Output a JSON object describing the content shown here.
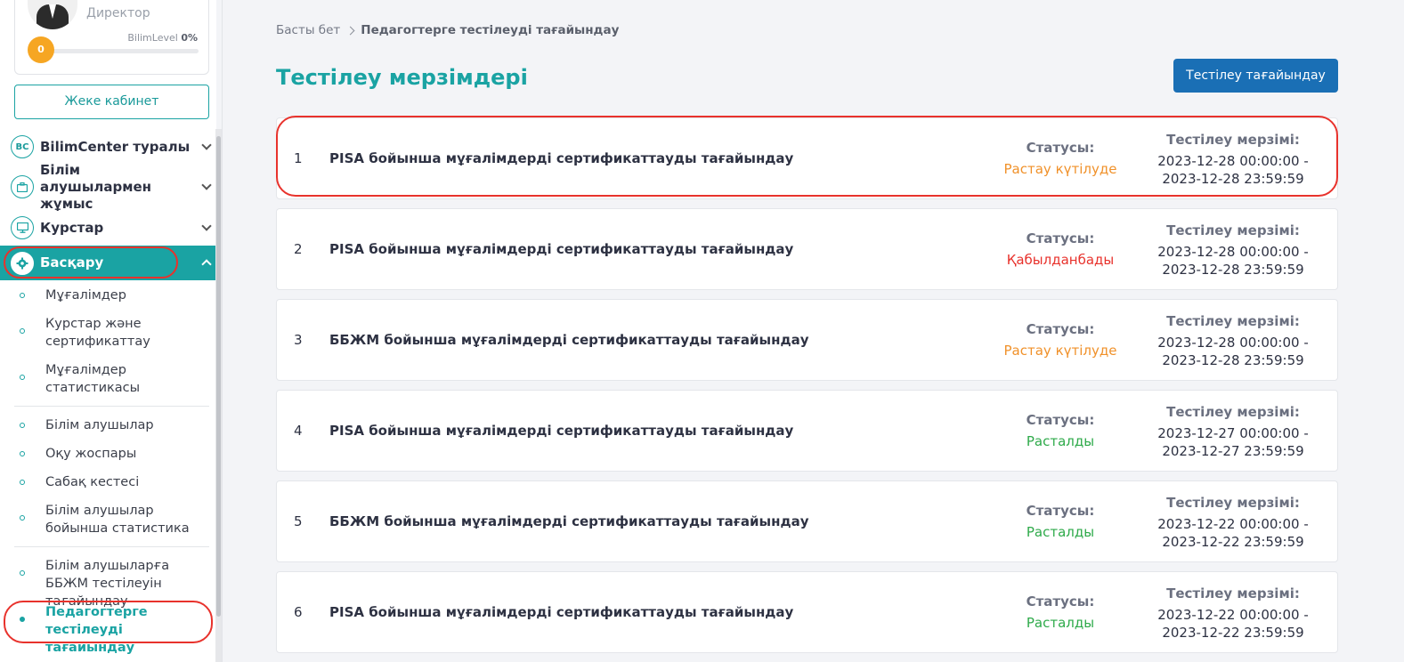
{
  "colors": {
    "accent": "#1aa3a3",
    "primary_button": "#1a6fb5",
    "highlight": "#e8322c",
    "status_pending": "#f0912a",
    "status_rejected": "#e8322c",
    "status_approved": "#2eaa4a",
    "level_badge": "#f6a623"
  },
  "profile": {
    "role": "Директор",
    "level_name": "BilimLevel",
    "level_percent": "0%",
    "level_value": "0",
    "level_fraction": 0
  },
  "sidebar": {
    "cabinet_button": "Жеке кабинет",
    "menu": [
      {
        "label": "BilimCenter туралы",
        "icon": "bc-logo-icon",
        "icon_text": "BC"
      },
      {
        "label": "Білім алушылармен жұмыс",
        "icon": "briefcase-icon"
      },
      {
        "label": "Курстар",
        "icon": "monitor-icon"
      },
      {
        "label": "Басқару",
        "icon": "gear-icon",
        "active": true
      }
    ],
    "sub_items": [
      {
        "label": "Мұғалімдер"
      },
      {
        "label": "Курстар және сертификаттау"
      },
      {
        "label": "Мұғалімдер статистикасы"
      },
      {
        "label": "Білім алушылар"
      },
      {
        "label": "Оқу жоспары"
      },
      {
        "label": "Сабақ кестесі"
      },
      {
        "label": "Білім алушылар бойынша статистика"
      },
      {
        "label": "Білім алушыларға ББЖМ тестілеуін тағайындау"
      },
      {
        "label": "Педагогтерге тестілеуді тағайындау",
        "active": true
      }
    ]
  },
  "breadcrumb": {
    "home": "Басты бет",
    "current": "Педагогтерге тестілеуді тағайындау"
  },
  "page": {
    "title": "Тестілеу мерзімдері",
    "assign_button": "Тестілеу тағайындау"
  },
  "table": {
    "status_label": "Статусы:",
    "deadline_label": "Тестілеу мерзімі:",
    "rows": [
      {
        "num": "1",
        "title": "PISA бойынша мұғалімдерді сертификаттауды тағайындау",
        "status": "Растау күтілуде",
        "status_type": "pending",
        "start": "2023-12-28 00:00:00 -",
        "end": "2023-12-28 23:59:59"
      },
      {
        "num": "2",
        "title": "PISA бойынша мұғалімдерді сертификаттауды тағайындау",
        "status": "Қабылданбады",
        "status_type": "rejected",
        "start": "2023-12-28 00:00:00 -",
        "end": "2023-12-28 23:59:59"
      },
      {
        "num": "3",
        "title": "ББЖМ бойынша мұғалімдерді сертификаттауды тағайындау",
        "status": "Растау күтілуде",
        "status_type": "pending",
        "start": "2023-12-28 00:00:00 -",
        "end": "2023-12-28 23:59:59"
      },
      {
        "num": "4",
        "title": "PISA бойынша мұғалімдерді сертификаттауды тағайындау",
        "status": "Расталды",
        "status_type": "approved",
        "start": "2023-12-27 00:00:00 -",
        "end": "2023-12-27 23:59:59"
      },
      {
        "num": "5",
        "title": "ББЖМ бойынша мұғалімдерді сертификаттауды тағайындау",
        "status": "Расталды",
        "status_type": "approved",
        "start": "2023-12-22 00:00:00 -",
        "end": "2023-12-22 23:59:59"
      },
      {
        "num": "6",
        "title": "PISA бойынша мұғалімдерді сертификаттауды тағайындау",
        "status": "Расталды",
        "status_type": "approved",
        "start": "2023-12-22 00:00:00 -",
        "end": "2023-12-22 23:59:59"
      }
    ]
  }
}
